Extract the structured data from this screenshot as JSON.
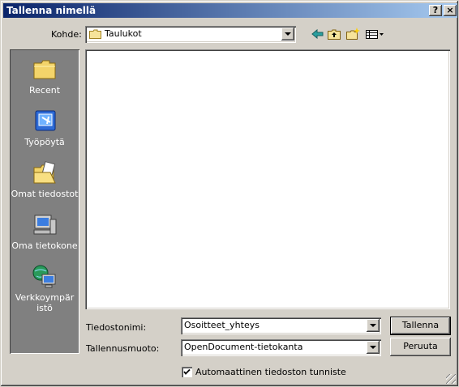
{
  "window": {
    "title": "Tallenna nimellä",
    "help_label": "?",
    "close_label": "×"
  },
  "location": {
    "label": "Kohde:",
    "value": "Taulukot"
  },
  "toolbar": {
    "icons": [
      "back-arrow-icon",
      "up-one-level-icon",
      "new-folder-icon",
      "views-menu-icon"
    ]
  },
  "places": [
    {
      "label": "Recent",
      "icon": "recent-folder-icon"
    },
    {
      "label": "Työpöytä",
      "icon": "desktop-icon"
    },
    {
      "label": "Omat tiedostot",
      "icon": "my-documents-icon"
    },
    {
      "label": "Oma tietokone",
      "icon": "my-computer-icon"
    },
    {
      "label": "Verkkoympäristö",
      "icon": "network-icon"
    }
  ],
  "places_split": {
    "line1": "Verkkoympäristö",
    "line1_text": "Verkkoympäristö"
  },
  "filename": {
    "label": "Tiedostonimi:",
    "value": "Osoitteet_yhteys"
  },
  "filetype": {
    "label": "Tallennusmuoto:",
    "value": "OpenDocument-tietokanta"
  },
  "buttons": {
    "save": "Tallenna",
    "cancel": "Peruuta"
  },
  "auto_extension": {
    "label": "Automaattinen tiedoston tunniste",
    "checked": true
  },
  "colors": {
    "title_start": "#0a246a",
    "title_end": "#a6caf0",
    "face": "#d4d0c8",
    "places_bg": "#808080"
  }
}
